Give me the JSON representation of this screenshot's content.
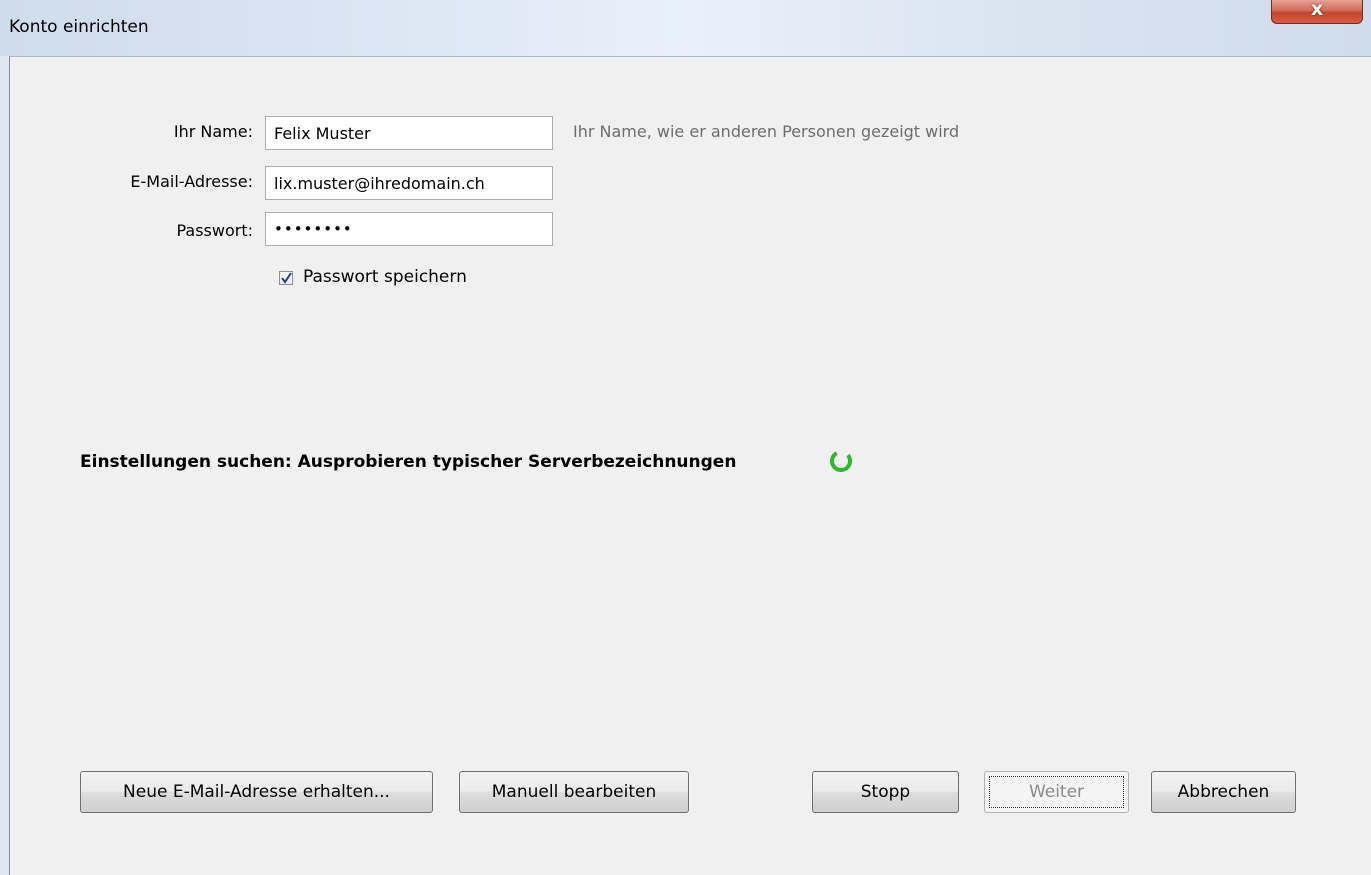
{
  "window": {
    "title": "Konto einrichten",
    "close_symbol": "x"
  },
  "form": {
    "name_label": "Ihr Name:",
    "name_value": "Felix Muster",
    "name_hint": "Ihr Name, wie er anderen Personen gezeigt wird",
    "email_label": "E-Mail-Adresse:",
    "email_value": "lix.muster@ihredomain.ch",
    "password_label": "Passwort:",
    "password_value": "••••••••",
    "remember_label": "Passwort speichern",
    "remember_checked": true
  },
  "status": {
    "text": "Einstellungen suchen: Ausprobieren typischer Serverbezeichnungen",
    "spinner_color": "#2db82d"
  },
  "buttons": {
    "new_email": "Neue E-Mail-Adresse erhalten...",
    "manual": "Manuell bearbeiten",
    "stop": "Stopp",
    "next": "Weiter",
    "cancel": "Abbrechen"
  }
}
